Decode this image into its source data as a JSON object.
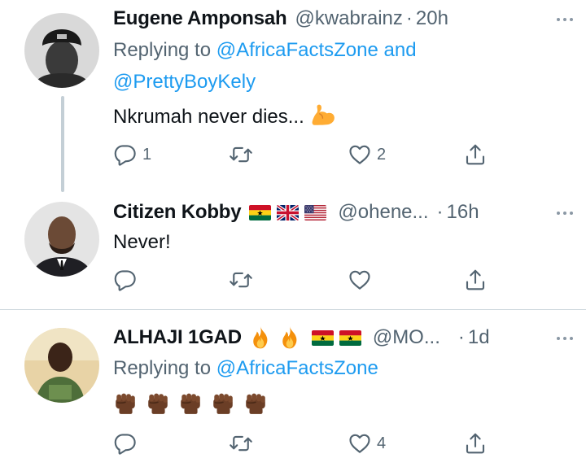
{
  "tweets": [
    {
      "name": "Eugene Amponsah",
      "handle": "@kwabrainz",
      "time": "20h",
      "replying_prefix": "Replying to",
      "replying_link_1": "@AfricaFactsZone",
      "replying_and": "and",
      "replying_link_2": "@PrettyBoyKely",
      "text": "Nkrumah never dies...",
      "text_emoji": "flexed-biceps",
      "reply_count": "1",
      "like_count": "2"
    },
    {
      "name": "Citizen Kobby",
      "flags": [
        "ghana",
        "uk",
        "usa"
      ],
      "handle": "@ohene...",
      "time": "16h",
      "text": "Never!"
    },
    {
      "name": "ALHAJI 1GAD",
      "name_emojis": [
        "fire",
        "fire"
      ],
      "flags": [
        "ghana",
        "ghana"
      ],
      "handle": "@MO...",
      "time": "1d",
      "replying_prefix": "Replying to",
      "replying_link_1": "@AfricaFactsZone",
      "fists": [
        "raised-fist-dark",
        "raised-fist-dark",
        "raised-fist-dark",
        "raised-fist-dark",
        "raised-fist-dark"
      ],
      "like_count": "4"
    }
  ],
  "icons": {
    "reply": "speech-bubble-icon",
    "retweet": "retweet-arrows-icon",
    "like": "heart-icon",
    "share": "share-upload-icon",
    "more": "ellipsis-icon"
  },
  "colors": {
    "link": "#1d9bf0",
    "secondary": "#536471",
    "thread_line": "#c4cfd6"
  }
}
